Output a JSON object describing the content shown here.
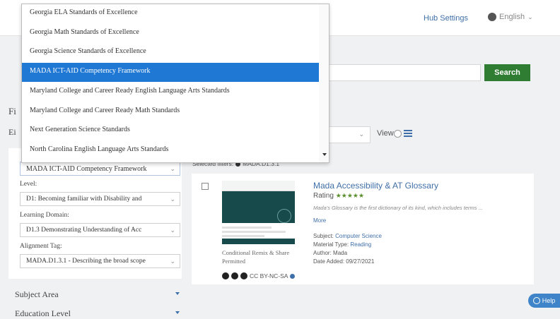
{
  "header": {
    "hub_settings": "Hub Settings",
    "language": "English"
  },
  "search": {
    "button_label": "Search"
  },
  "partial_text": {
    "f": "Fi",
    "e": "Ei"
  },
  "view": {
    "label": "View"
  },
  "filters": {
    "framework_value": "MADA ICT-AID Competency Framework",
    "level_label": "Level:",
    "level_value": "D1: Becoming familiar with Disability and",
    "domain_label": "Learning Domain:",
    "domain_value": "D1.3 Demonstrating Understanding of Acc",
    "tag_label": "Alignment Tag:",
    "tag_value": "MADA.D1.3.1 - Describing the broad scope",
    "subject_area": "Subject Area",
    "education_level": "Education Level"
  },
  "selected_filters": {
    "label": "Selected filters:",
    "chip": "MADA.D1.3.1"
  },
  "dropdown": {
    "items": [
      "Georgia ELA Standards of Excellence",
      "Georgia Math Standards of Excellence",
      "Georgia Science Standards of Excellence",
      "MADA ICT-AID Competency Framework",
      "Maryland College and Career Ready English Language Arts Standards",
      "Maryland College and Career Ready Math Standards",
      "Next Generation Science Standards",
      "North Carolina English Language Arts Standards"
    ],
    "active_index": 3
  },
  "result": {
    "title": "Mada Accessibility & AT Glossary",
    "rating_label": "Rating",
    "stars": "★★★★★",
    "description": "Mada's Glossary is the first dictionary of its kind, which includes terms ...",
    "more": "More",
    "subject_label": "Subject:",
    "subject_value": "Computer Science",
    "material_label": "Material Type:",
    "material_value": "Reading",
    "author_label": "Author:",
    "author_value": "Mada",
    "date_label": "Date Added:",
    "date_value": "09/27/2021",
    "license_text": "Conditional Remix & Share Permitted",
    "cc_label": "CC BY-NC-SA"
  },
  "help": {
    "label": "Help"
  },
  "colors": {
    "accent": "#3f6fa8",
    "search_green": "#2e7d32",
    "dropdown_active": "#1e78d4"
  }
}
